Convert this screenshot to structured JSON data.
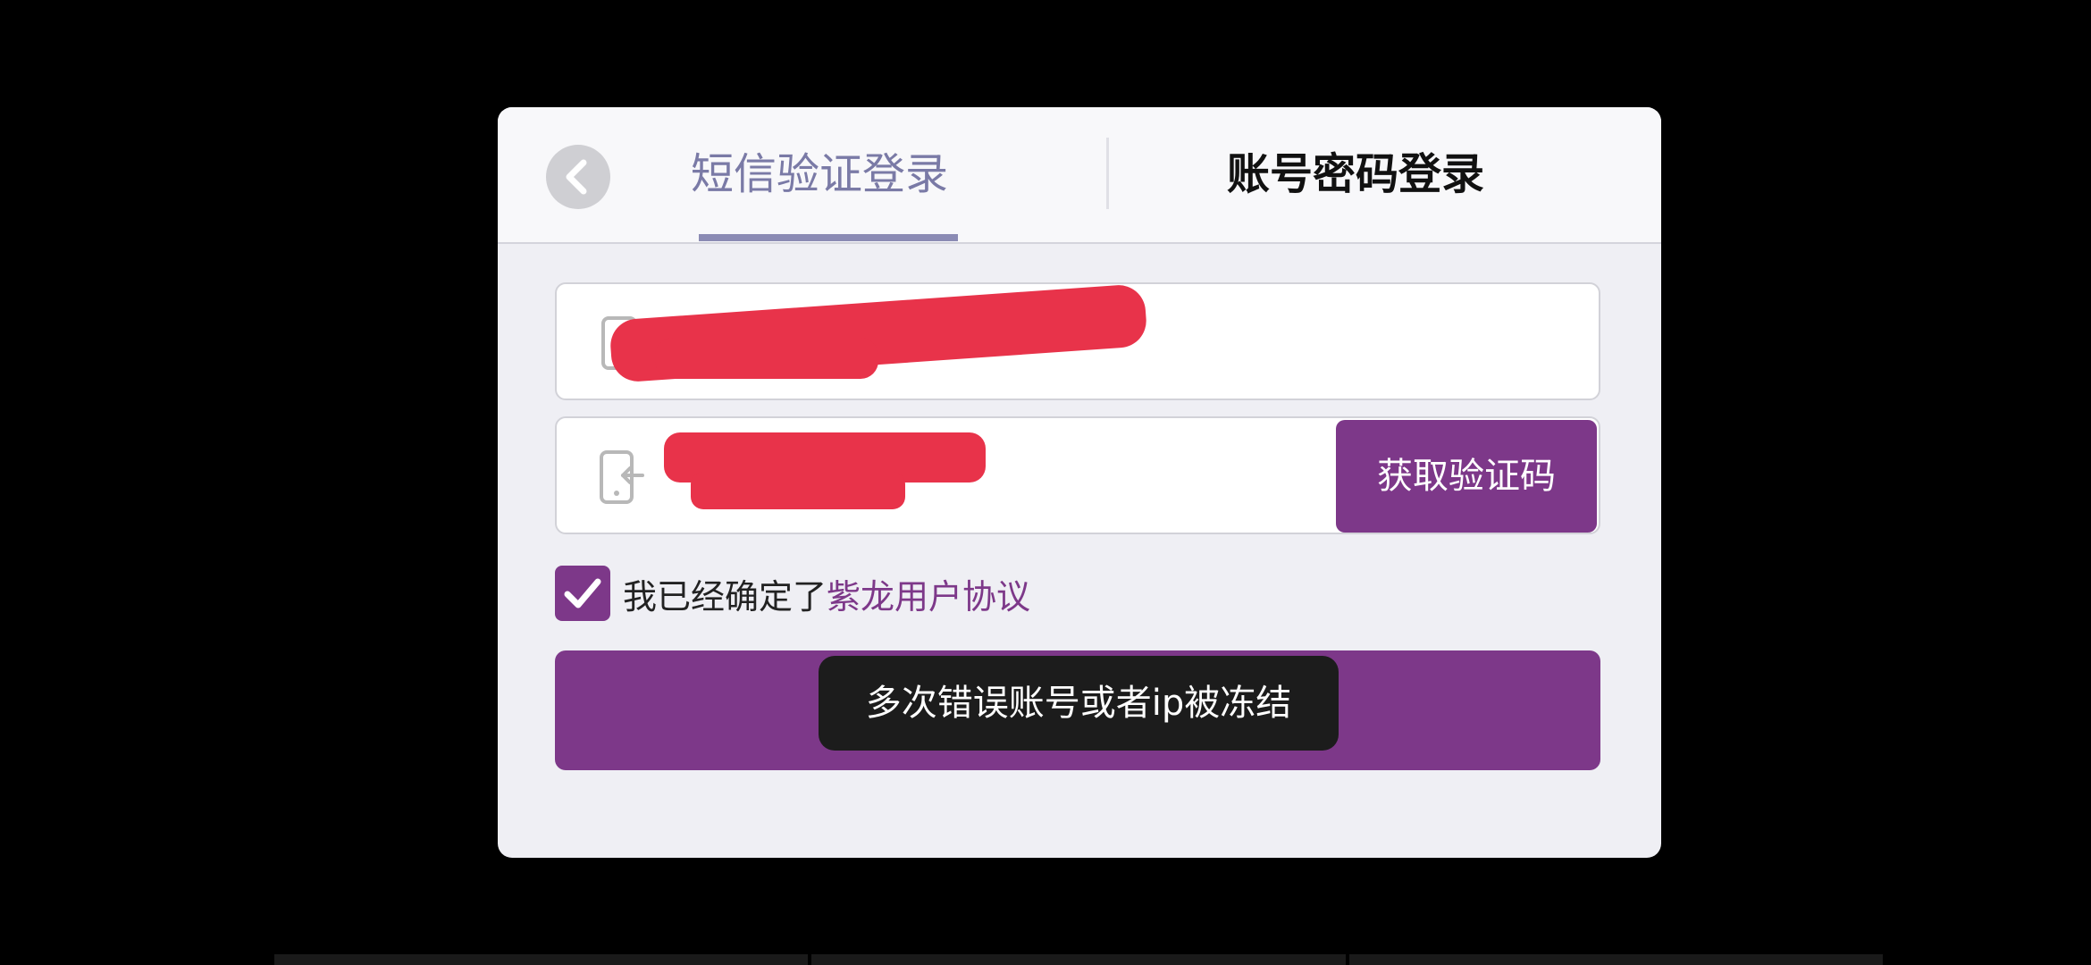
{
  "header": {
    "tabs": [
      {
        "label": "短信验证登录",
        "active": true
      },
      {
        "label": "账号密码登录",
        "active": false
      }
    ]
  },
  "form": {
    "phone": {
      "value": "",
      "placeholder": "",
      "icon": "phone-icon"
    },
    "code": {
      "value": "",
      "placeholder": "",
      "icon": "phone-login-icon"
    },
    "get_code_label": "获取验证码"
  },
  "agreement": {
    "checked": true,
    "text": "我已经确定了",
    "link_text": "紫龙用户协议"
  },
  "toast": {
    "message": "多次错误账号或者ip被冻结"
  },
  "colors": {
    "accent": "#7d3889",
    "active_tab": "#7a7aa6",
    "redaction": "#e8334a",
    "toast_bg": "#1c1c1c"
  }
}
